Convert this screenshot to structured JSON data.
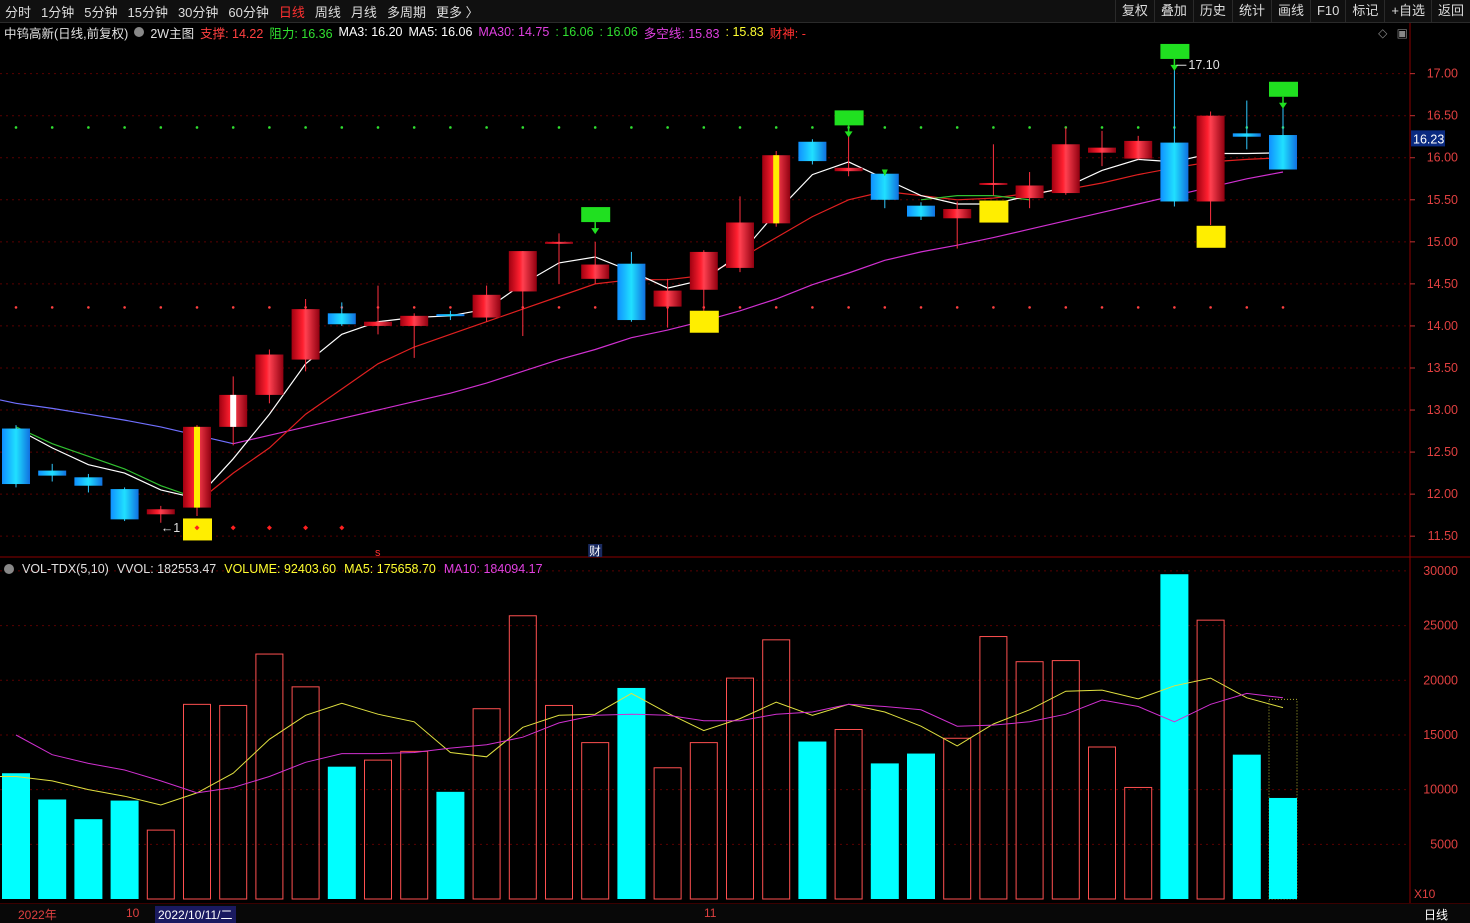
{
  "topbar": {
    "tabs": [
      "分时",
      "1分钟",
      "5分钟",
      "15分钟",
      "30分钟",
      "60分钟",
      "日线",
      "周线",
      "月线",
      "多周期",
      "更多 〉"
    ],
    "active_tab": "日线",
    "right_buttons": [
      "复权",
      "叠加",
      "历史",
      "统计",
      "画线",
      "F10",
      "标记",
      "+自选",
      "返回"
    ]
  },
  "info": {
    "title": "中钨高新(日线,前复权)",
    "indicator": "2W主图",
    "support": "支撑: 14.22",
    "resistance": "阻力: 16.36",
    "ma3": "MA3: 16.20",
    "ma5": "MA5: 16.06",
    "ma30": "MA30: 14.75",
    "v1": ": 16.06",
    "v2": ": 16.06",
    "duokong": "多空线: 15.83",
    "v3": ": 15.83",
    "caishen": "财神: -"
  },
  "volinfo": {
    "name": "VOL-TDX(5,10)",
    "vvol": "VVOL: 182553.47",
    "volume": "VOLUME: 92403.60",
    "ma5": "MA5: 175658.70",
    "ma10": "MA10: 184094.17"
  },
  "price_axis": [
    "17.00",
    "16.50",
    "16.00",
    "15.50",
    "15.00",
    "14.50",
    "14.00",
    "13.50",
    "13.00",
    "12.50",
    "12.00",
    "11.50"
  ],
  "vol_axis": [
    "30000",
    "25000",
    "20000",
    "15000",
    "10000",
    "5000"
  ],
  "vol_unit": "X10",
  "current_price_tag": "16.23",
  "high_label": "17.10",
  "low_label": "←1",
  "markers": {
    "s": "s",
    "cai": "财"
  },
  "bottom": {
    "year": "2022年",
    "m10": "10",
    "date": "2022/10/11/二",
    "m11": "11",
    "period": "日线"
  },
  "colors": {
    "up": "#ff3030",
    "down": "#1ec8ff",
    "ma_white": "#ffffff",
    "ma_red": "#e02020",
    "ma_magenta": "#d030d0",
    "volume_down": "#00ffff",
    "grid": "#5a0000"
  },
  "chart_data": {
    "type": "candlestick",
    "price_ylim": [
      11.3,
      17.4
    ],
    "volume_ylim": [
      0,
      31000
    ],
    "candles": [
      {
        "o": 12.78,
        "h": 12.82,
        "l": 12.08,
        "c": 12.12
      },
      {
        "o": 12.28,
        "h": 12.36,
        "l": 12.15,
        "c": 12.22
      },
      {
        "o": 12.2,
        "h": 12.24,
        "l": 12.02,
        "c": 12.1
      },
      {
        "o": 12.06,
        "h": 12.08,
        "l": 11.68,
        "c": 11.7
      },
      {
        "o": 11.76,
        "h": 11.86,
        "l": 11.66,
        "c": 11.82
      },
      {
        "o": 11.84,
        "h": 12.82,
        "l": 11.74,
        "c": 12.8
      },
      {
        "o": 12.8,
        "h": 13.4,
        "l": 12.58,
        "c": 13.18
      },
      {
        "o": 13.18,
        "h": 13.72,
        "l": 13.08,
        "c": 13.66
      },
      {
        "o": 13.6,
        "h": 14.32,
        "l": 13.46,
        "c": 14.2
      },
      {
        "o": 14.15,
        "h": 14.28,
        "l": 14.0,
        "c": 14.02
      },
      {
        "o": 14.0,
        "h": 14.48,
        "l": 13.9,
        "c": 14.05
      },
      {
        "o": 14.0,
        "h": 14.15,
        "l": 13.62,
        "c": 14.12
      },
      {
        "o": 14.14,
        "h": 14.18,
        "l": 14.07,
        "c": 14.12
      },
      {
        "o": 14.1,
        "h": 14.48,
        "l": 14.05,
        "c": 14.37
      },
      {
        "o": 14.41,
        "h": 14.89,
        "l": 13.88,
        "c": 14.89
      },
      {
        "o": 15.0,
        "h": 15.1,
        "l": 14.5,
        "c": 15.0
      },
      {
        "o": 14.56,
        "h": 15.0,
        "l": 14.5,
        "c": 14.73
      },
      {
        "o": 14.74,
        "h": 14.88,
        "l": 14.05,
        "c": 14.07
      },
      {
        "o": 14.23,
        "h": 14.56,
        "l": 13.98,
        "c": 14.42
      },
      {
        "o": 14.43,
        "h": 14.9,
        "l": 14.18,
        "c": 14.88
      },
      {
        "o": 14.69,
        "h": 15.54,
        "l": 14.64,
        "c": 15.23
      },
      {
        "o": 15.22,
        "h": 16.08,
        "l": 15.18,
        "c": 16.03
      },
      {
        "o": 16.19,
        "h": 16.22,
        "l": 15.92,
        "c": 15.96
      },
      {
        "o": 15.84,
        "h": 16.38,
        "l": 15.78,
        "c": 15.88
      },
      {
        "o": 15.81,
        "h": 15.84,
        "l": 15.4,
        "c": 15.5
      },
      {
        "o": 15.43,
        "h": 15.47,
        "l": 15.26,
        "c": 15.3
      },
      {
        "o": 15.28,
        "h": 15.48,
        "l": 14.92,
        "c": 15.39
      },
      {
        "o": 15.7,
        "h": 16.16,
        "l": 15.55,
        "c": 15.7
      },
      {
        "o": 15.52,
        "h": 15.83,
        "l": 15.4,
        "c": 15.67
      },
      {
        "o": 15.58,
        "h": 16.36,
        "l": 15.56,
        "c": 16.16
      },
      {
        "o": 16.06,
        "h": 16.32,
        "l": 15.9,
        "c": 16.12
      },
      {
        "o": 15.99,
        "h": 16.26,
        "l": 15.98,
        "c": 16.2
      },
      {
        "o": 16.18,
        "h": 17.1,
        "l": 15.42,
        "c": 15.48
      },
      {
        "o": 15.48,
        "h": 16.55,
        "l": 15.2,
        "c": 16.5
      },
      {
        "o": 16.29,
        "h": 16.68,
        "l": 16.1,
        "c": 16.25
      },
      {
        "o": 16.27,
        "h": 16.72,
        "l": 15.88,
        "c": 15.86
      }
    ],
    "volume": [
      11500,
      9100,
      7300,
      9000,
      6300,
      17800,
      17700,
      22400,
      19400,
      12100,
      12700,
      13500,
      9800,
      17400,
      25900,
      17700,
      14300,
      19300,
      12000,
      14300,
      20200,
      23700,
      14400,
      15500,
      12400,
      13300,
      14700,
      24000,
      21700,
      21800,
      13900,
      10200,
      29700,
      25500,
      13200,
      9240
    ],
    "ma_white": [
      12.78,
      12.55,
      12.35,
      12.25,
      12.05,
      11.95,
      12.42,
      12.95,
      13.55,
      13.9,
      14.05,
      14.1,
      14.12,
      14.2,
      14.5,
      14.75,
      14.82,
      14.65,
      14.45,
      14.55,
      14.85,
      15.35,
      15.8,
      15.95,
      15.75,
      15.55,
      15.45,
      15.45,
      15.55,
      15.65,
      15.85,
      15.98,
      15.95,
      16.05,
      16.05,
      16.06
    ],
    "ma_red": [
      null,
      null,
      null,
      null,
      null,
      11.9,
      12.25,
      12.55,
      12.95,
      13.25,
      13.55,
      13.75,
      13.9,
      14.05,
      14.2,
      14.35,
      14.5,
      14.55,
      14.55,
      14.6,
      14.8,
      15.05,
      15.3,
      15.5,
      15.6,
      15.55,
      15.5,
      15.52,
      15.58,
      15.62,
      15.7,
      15.8,
      15.88,
      15.95,
      15.98,
      16.0
    ],
    "ma_green": [
      12.8,
      12.6,
      12.45,
      12.3,
      12.1,
      11.95,
      null,
      null,
      null,
      null,
      null,
      null,
      null,
      null,
      null,
      null,
      null,
      null,
      null,
      null,
      null,
      null,
      null,
      null,
      null,
      15.5,
      15.55,
      15.55,
      15.5,
      null,
      null,
      null,
      null,
      null,
      null,
      null
    ],
    "ma_blue": [
      13.08,
      13.02,
      12.95,
      12.88,
      12.8,
      12.7,
      12.6,
      null,
      null,
      null,
      null,
      null,
      null,
      null,
      null,
      null,
      null,
      null,
      null,
      null,
      null,
      null,
      null,
      null,
      null,
      null,
      null,
      null,
      null,
      null,
      null,
      null,
      null,
      null,
      null,
      null
    ],
    "ma_magenta": [
      null,
      null,
      null,
      null,
      null,
      null,
      12.6,
      12.7,
      12.8,
      12.9,
      13.0,
      13.1,
      13.2,
      13.32,
      13.46,
      13.6,
      13.72,
      13.86,
      13.95,
      14.06,
      14.18,
      14.32,
      14.49,
      14.63,
      14.78,
      14.88,
      14.96,
      15.05,
      15.15,
      15.25,
      15.35,
      15.45,
      15.55,
      15.65,
      15.75,
      15.83
    ],
    "vol_ma5": [
      11200,
      10800,
      10000,
      9400,
      8600,
      9700,
      11500,
      14600,
      16800,
      17900,
      16900,
      16200,
      13400,
      13000,
      15700,
      16800,
      16900,
      18800,
      17000,
      15400,
      16500,
      18000,
      16800,
      17800,
      17100,
      15800,
      14000,
      16000,
      17300,
      19000,
      19100,
      18300,
      19500,
      20200,
      18400,
      17500
    ],
    "vol_ma10": [
      15000,
      13200,
      12400,
      11800,
      10800,
      9700,
      10200,
      11200,
      12500,
      13300,
      13300,
      13400,
      13800,
      14100,
      14800,
      16100,
      16800,
      16900,
      16800,
      16300,
      16300,
      16900,
      17100,
      17800,
      17600,
      17300,
      15800,
      15900,
      16200,
      16900,
      18200,
      17600,
      16200,
      17800,
      18800,
      18400
    ]
  }
}
